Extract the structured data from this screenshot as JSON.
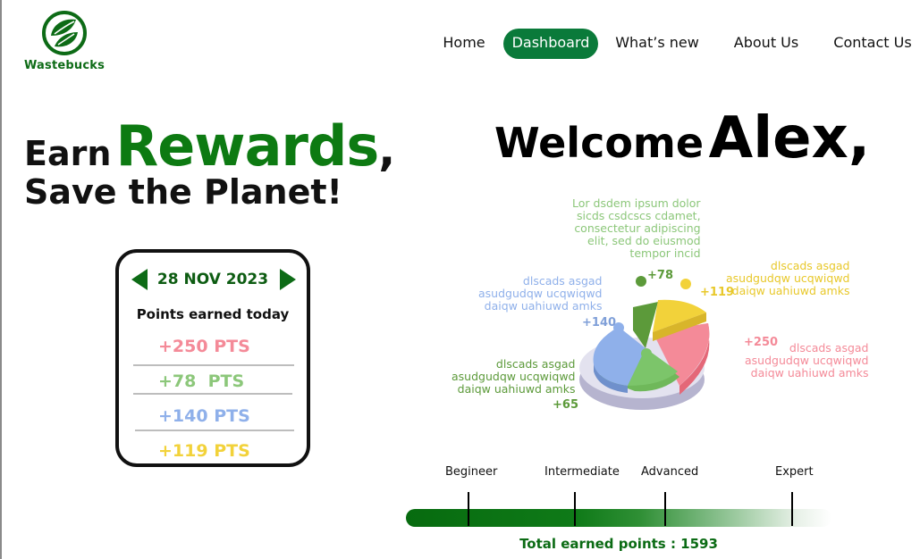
{
  "brand": {
    "name": "Wastebucks",
    "logo_icon": "leaf-cycle-icon",
    "color": "#0d6b16"
  },
  "nav": {
    "items": [
      "Home",
      "Dashboard",
      "What’s new",
      "About Us",
      "Contact Us"
    ],
    "active": "Dashboard"
  },
  "hero": {
    "line1_prefix": "Earn",
    "line1_highlight": "Rewards",
    "line1_suffix": ",",
    "line2": "Save the Planet!"
  },
  "points_card": {
    "date": "28 NOV 2023",
    "prev_icon": "arrow-left-icon",
    "next_icon": "arrow-right-icon",
    "title": "Points earned today",
    "entries": [
      {
        "text": "+250 PTS",
        "color": "#f48a98"
      },
      {
        "text": "+78  PTS",
        "color": "#8cc77a"
      },
      {
        "text": "+140 PTS",
        "color": "#8fb0ea"
      },
      {
        "text": "+119 PTS",
        "color": "#f2d23a"
      }
    ]
  },
  "welcome": {
    "greeting": "Welcome",
    "name": "Alex,"
  },
  "chart_data": {
    "type": "pie",
    "title": "",
    "slices": [
      {
        "label": "+250",
        "value": 250,
        "color": "#f48a98"
      },
      {
        "label": "+140",
        "value": 140,
        "color": "#8fb0ea"
      },
      {
        "label": "+65",
        "value": 65,
        "color": "#7cc56a"
      },
      {
        "label": "+78",
        "value": 78,
        "color": "#5c9a3a"
      },
      {
        "label": "+119",
        "value": 119,
        "color": "#f2d23a"
      }
    ],
    "annotations": {
      "top": [
        "Lor dsdem ipsum dolor",
        "sicds csdcscs cdamet,",
        "consectetur adipiscing",
        "elit, sed do eiusmod",
        "tempor incid"
      ],
      "blue": [
        "dlscads asgad",
        "asudgudqw ucqwiqwd",
        "daiqw uahiuwd amks"
      ],
      "green": [
        "dlscads asgad",
        "asudgudqw ucqwiqwd",
        "daiqw uahiuwd amks"
      ],
      "yellow": [
        "dlscads asgad",
        "asudgudqw ucqwiqwd",
        "daiqw uahiuwd amks"
      ],
      "pink": [
        "dlscads asgad",
        "asudgudqw ucqwiqwd",
        "daiqw uahiuwd amks"
      ]
    }
  },
  "progress": {
    "levels": [
      "Begineer",
      "Intermediate",
      "Advanced",
      "Expert"
    ],
    "total_label": "Total earned points : 1593",
    "fill_fraction": 0.62
  }
}
